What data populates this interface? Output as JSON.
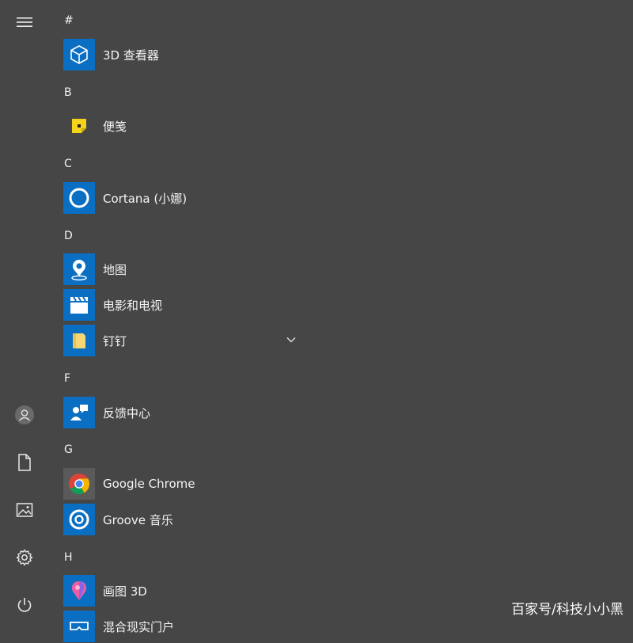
{
  "colors": {
    "bg": "#464646",
    "tile_blue": "#0a6fc2",
    "sticky_yellow": "#f5d31b",
    "chrome_tile": "#5a5a5a"
  },
  "headers": {
    "hash": "#",
    "b": "B",
    "c": "C",
    "d": "D",
    "f": "F",
    "g": "G",
    "h": "H"
  },
  "apps": {
    "viewer3d": {
      "label": "3D 查看器",
      "icon": "cube-icon"
    },
    "sticky": {
      "label": "便笺",
      "icon": "sticky-note-icon"
    },
    "cortana": {
      "label": "Cortana (小娜)",
      "icon": "cortana-ring-icon"
    },
    "maps": {
      "label": "地图",
      "icon": "map-pin-icon"
    },
    "movies": {
      "label": "电影和电视",
      "icon": "clapperboard-icon"
    },
    "dingding": {
      "label": "钉钉",
      "icon": "folder-icon"
    },
    "feedback": {
      "label": "反馈中心",
      "icon": "feedback-icon"
    },
    "chrome": {
      "label": "Google Chrome",
      "icon": "chrome-icon"
    },
    "groove": {
      "label": "Groove 音乐",
      "icon": "groove-icon"
    },
    "paint3d": {
      "label": "画图 3D",
      "icon": "paint3d-icon"
    },
    "mixedreality": {
      "label": "混合现实门户",
      "icon": "mixed-reality-icon"
    }
  },
  "rail": {
    "menu": "hamburger-icon",
    "user": "user-icon",
    "documents": "document-icon",
    "pictures": "picture-icon",
    "settings": "gear-icon",
    "power": "power-icon"
  },
  "watermark": "百家号/科技小小黑"
}
